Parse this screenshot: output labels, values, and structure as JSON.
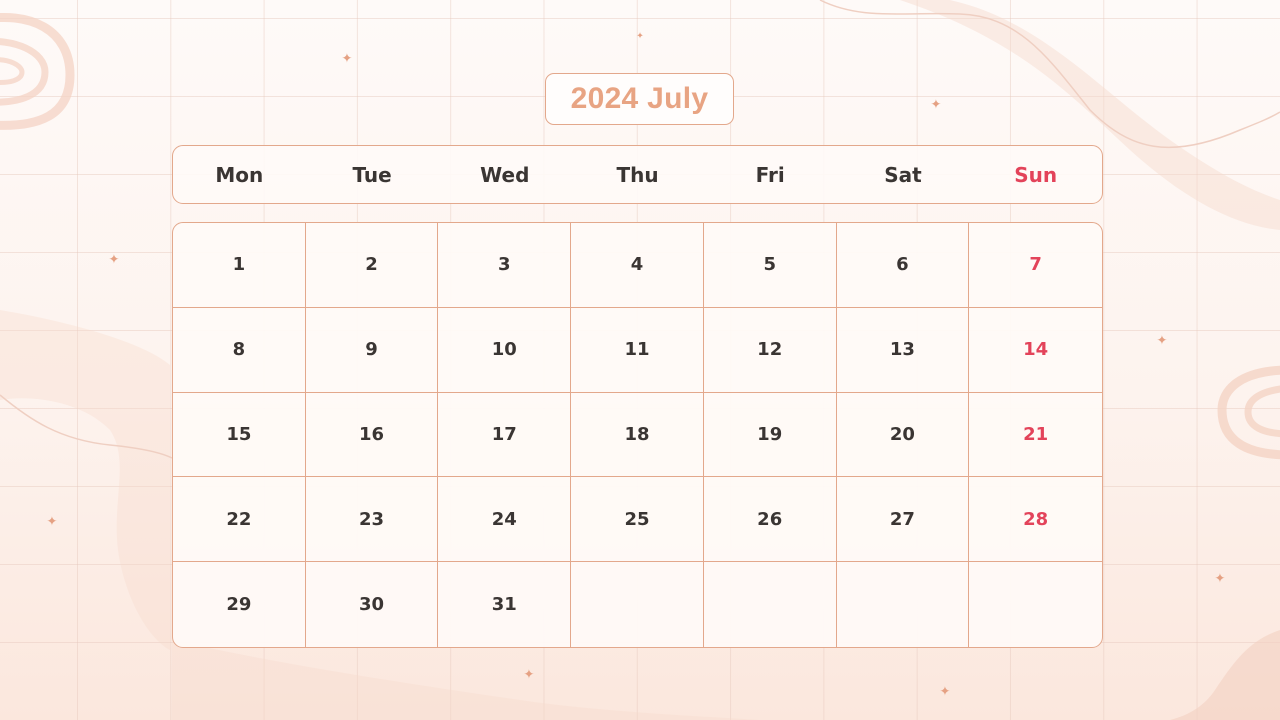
{
  "title": "2024 July",
  "colors": {
    "accent": "#e8a483",
    "border": "#e3a88c",
    "text": "#3a3533",
    "sunday": "#e3435a"
  },
  "weekdays": [
    "Mon",
    "Tue",
    "Wed",
    "Thu",
    "Fri",
    "Sat",
    "Sun"
  ],
  "weeks": [
    [
      "1",
      "2",
      "3",
      "4",
      "5",
      "6",
      "7"
    ],
    [
      "8",
      "9",
      "10",
      "11",
      "12",
      "13",
      "14"
    ],
    [
      "15",
      "16",
      "17",
      "18",
      "19",
      "20",
      "21"
    ],
    [
      "22",
      "23",
      "24",
      "25",
      "26",
      "27",
      "28"
    ],
    [
      "29",
      "30",
      "31",
      "",
      "",
      "",
      ""
    ]
  ],
  "decorations": {
    "sparkle_icon": "✦"
  }
}
